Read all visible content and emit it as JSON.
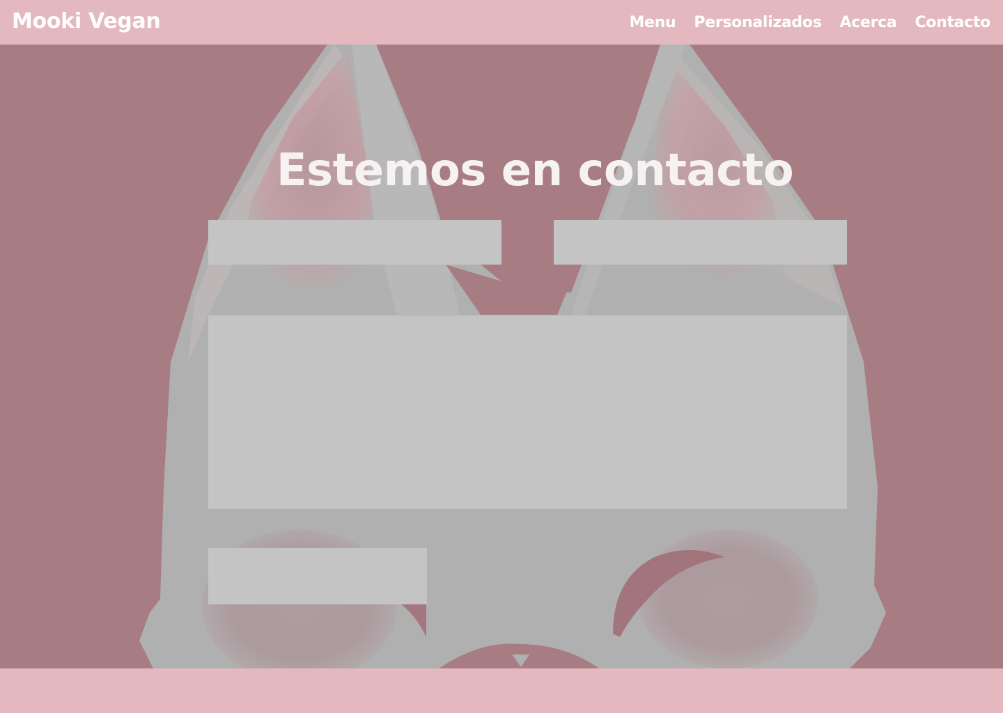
{
  "navbar": {
    "brand": "Mooki Vegan",
    "links": [
      {
        "label": "Menu"
      },
      {
        "label": "Personalizados"
      },
      {
        "label": "Acerca"
      },
      {
        "label": "Contacto"
      }
    ]
  },
  "contact": {
    "title": "Estemos en contacto",
    "name_value": "",
    "email_value": "",
    "message_value": "",
    "submit_label": ""
  },
  "colors": {
    "navbar_bg": "#e3b8bf",
    "hero_bg": "#a77c83",
    "field_bg": "#c4c4c4",
    "title_text": "#f7f2f2"
  }
}
